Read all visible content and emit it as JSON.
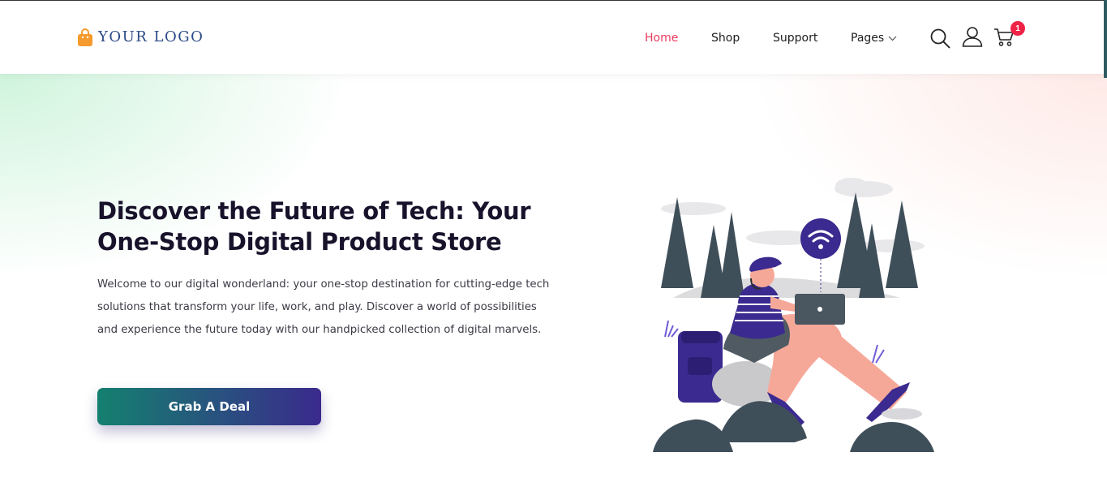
{
  "header": {
    "logo_text": "YOUR LOGO",
    "nav": {
      "home": "Home",
      "shop": "Shop",
      "support": "Support",
      "pages": "Pages"
    },
    "cart_count": "1",
    "icons": [
      "search-icon",
      "user-icon",
      "cart-icon",
      "chevron-down-icon",
      "shopping-bag-icon"
    ]
  },
  "hero": {
    "title_line1": "Discover the Future of Tech: Your",
    "title_line2": "One-Stop Digital Product Store",
    "description": "Welcome to our digital wonderland: your one-stop destination for cutting-edge tech solutions that transform your life, work, and play. Discover a world of possibilities and experience the future today with our handpicked collection of digital marvels.",
    "cta_label": "Grab A Deal"
  },
  "colors": {
    "accent_nav": "#ec3a5e",
    "logo": "#2a4a86",
    "logo_bag": "#f59a2c",
    "cta_start": "#14806f",
    "cta_end": "#3a2a8c",
    "badge": "#ee2346",
    "title": "#18122b"
  }
}
